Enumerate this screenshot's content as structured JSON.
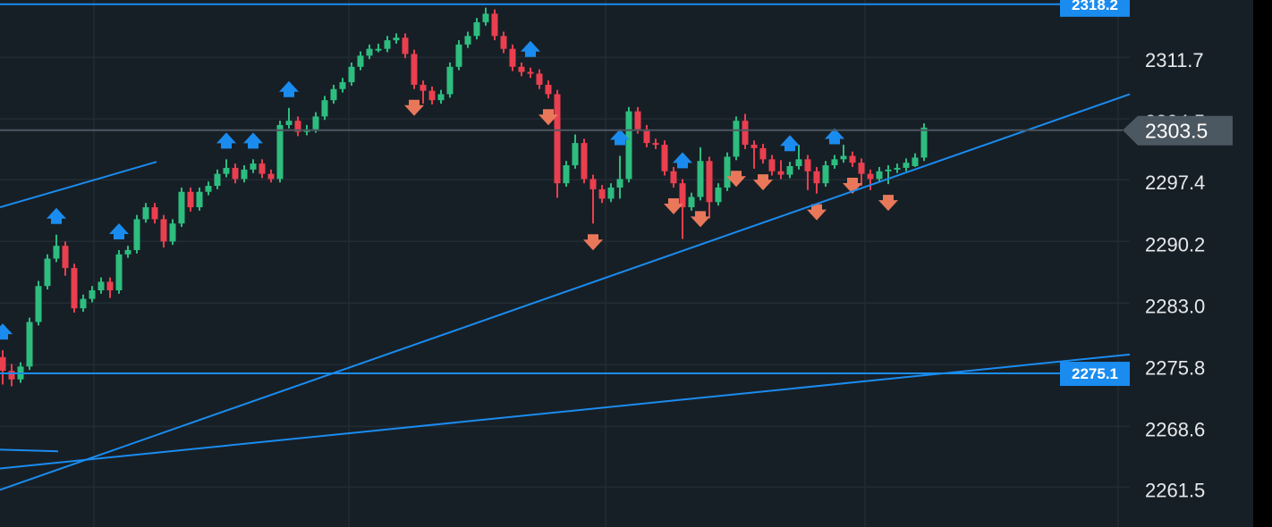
{
  "chart_data": {
    "type": "candlestick",
    "title": "",
    "y_axis": {
      "ticks": [
        "2311.7",
        "2304.5",
        "2297.4",
        "2290.2",
        "2283.0",
        "2275.8",
        "2268.6",
        "2261.5"
      ],
      "tick_values": [
        2311.7,
        2304.5,
        2297.4,
        2290.2,
        2283.0,
        2275.8,
        2268.6,
        2261.5
      ],
      "range": [
        2258.0,
        2318.7
      ]
    },
    "grid": true,
    "last_price": {
      "value": 2303.5,
      "label": "2303.5"
    },
    "horizontal_levels": [
      {
        "value": 2318.2,
        "label": "2318.2"
      },
      {
        "value": 2275.1,
        "label": "2275.1"
      }
    ],
    "trendlines": [
      {
        "from": [
          -0.3,
          2294.5
        ],
        "to": [
          17.2,
          2299.8
        ]
      },
      {
        "from": [
          -0.3,
          2261.5
        ],
        "to": [
          126.0,
          2307.7
        ]
      },
      {
        "from": [
          -0.3,
          2264.0
        ],
        "to": [
          126.0,
          2277.3
        ]
      },
      {
        "from": [
          -0.3,
          2266.2
        ],
        "to": [
          6.2,
          2266.0
        ]
      }
    ],
    "signals": {
      "buy": [
        0,
        6,
        13,
        25,
        28,
        32,
        59,
        69,
        76,
        88,
        93
      ],
      "sell": [
        46,
        61,
        66,
        75,
        78,
        82,
        85,
        91,
        95,
        99
      ]
    },
    "candles": [
      [
        2277.0,
        2277.8,
        2273.8,
        2275.4
      ],
      [
        2275.4,
        2276.2,
        2273.6,
        2274.4
      ],
      [
        2274.4,
        2276.4,
        2274.0,
        2275.9
      ],
      [
        2275.9,
        2281.6,
        2275.5,
        2281.1
      ],
      [
        2281.1,
        2285.9,
        2280.7,
        2285.3
      ],
      [
        2285.3,
        2289.0,
        2284.9,
        2288.5
      ],
      [
        2288.5,
        2291.3,
        2288.1,
        2290.0
      ],
      [
        2290.0,
        2290.5,
        2286.5,
        2287.4
      ],
      [
        2287.4,
        2287.9,
        2282.2,
        2282.7
      ],
      [
        2282.7,
        2284.3,
        2282.3,
        2283.8
      ],
      [
        2283.8,
        2285.3,
        2283.4,
        2284.8
      ],
      [
        2284.8,
        2286.3,
        2284.4,
        2285.8
      ],
      [
        2285.8,
        2286.3,
        2283.9,
        2284.8
      ],
      [
        2284.8,
        2289.5,
        2284.4,
        2289.0
      ],
      [
        2289.0,
        2290.0,
        2288.6,
        2289.5
      ],
      [
        2289.5,
        2293.6,
        2289.1,
        2293.1
      ],
      [
        2293.1,
        2295.0,
        2292.7,
        2294.5
      ],
      [
        2294.5,
        2295.0,
        2292.6,
        2293.1
      ],
      [
        2293.1,
        2293.6,
        2289.8,
        2290.5
      ],
      [
        2290.5,
        2293.1,
        2290.1,
        2292.6
      ],
      [
        2292.6,
        2296.8,
        2292.2,
        2296.3
      ],
      [
        2296.3,
        2296.8,
        2294.0,
        2294.5
      ],
      [
        2294.5,
        2296.8,
        2294.1,
        2296.3
      ],
      [
        2296.3,
        2297.5,
        2295.9,
        2297.0
      ],
      [
        2297.0,
        2298.9,
        2296.6,
        2298.4
      ],
      [
        2298.4,
        2300.1,
        2298.0,
        2299.1
      ],
      [
        2299.1,
        2299.6,
        2297.3,
        2297.8
      ],
      [
        2297.8,
        2299.4,
        2297.4,
        2298.9
      ],
      [
        2298.9,
        2300.1,
        2298.5,
        2299.6
      ],
      [
        2299.6,
        2300.1,
        2297.9,
        2298.4
      ],
      [
        2298.4,
        2298.9,
        2297.4,
        2297.8
      ],
      [
        2297.8,
        2304.6,
        2297.4,
        2304.1
      ],
      [
        2304.1,
        2306.1,
        2303.7,
        2304.6
      ],
      [
        2304.6,
        2305.1,
        2302.8,
        2303.3
      ],
      [
        2303.3,
        2304.1,
        2302.9,
        2303.6
      ],
      [
        2303.6,
        2305.6,
        2303.2,
        2305.1
      ],
      [
        2305.1,
        2307.5,
        2304.7,
        2307.0
      ],
      [
        2307.0,
        2308.8,
        2306.6,
        2308.3
      ],
      [
        2308.3,
        2309.6,
        2307.9,
        2309.1
      ],
      [
        2309.1,
        2311.4,
        2308.7,
        2310.9
      ],
      [
        2310.9,
        2312.7,
        2310.5,
        2312.2
      ],
      [
        2312.2,
        2313.5,
        2311.8,
        2313.0
      ],
      [
        2313.0,
        2313.6,
        2312.6,
        2313.0
      ],
      [
        2313.0,
        2314.5,
        2312.6,
        2314.0
      ],
      [
        2314.0,
        2314.8,
        2313.6,
        2314.3
      ],
      [
        2314.3,
        2314.8,
        2311.9,
        2312.4
      ],
      [
        2312.4,
        2312.9,
        2308.3,
        2308.8
      ],
      [
        2308.8,
        2309.3,
        2306.6,
        2308.1
      ],
      [
        2308.1,
        2308.6,
        2306.5,
        2307.0
      ],
      [
        2307.0,
        2308.2,
        2306.6,
        2307.7
      ],
      [
        2307.7,
        2311.4,
        2307.3,
        2310.9
      ],
      [
        2310.9,
        2314.0,
        2310.5,
        2313.5
      ],
      [
        2313.5,
        2315.0,
        2313.1,
        2314.5
      ],
      [
        2314.5,
        2316.6,
        2314.1,
        2316.1
      ],
      [
        2316.1,
        2317.8,
        2315.7,
        2317.1
      ],
      [
        2317.1,
        2317.6,
        2314.0,
        2314.5
      ],
      [
        2314.5,
        2315.0,
        2312.5,
        2313.0
      ],
      [
        2313.0,
        2313.5,
        2310.4,
        2310.9
      ],
      [
        2310.9,
        2311.4,
        2309.8,
        2310.3
      ],
      [
        2310.3,
        2310.8,
        2309.6,
        2310.1
      ],
      [
        2310.1,
        2310.6,
        2308.3,
        2308.8
      ],
      [
        2308.8,
        2309.3,
        2307.2,
        2307.7
      ],
      [
        2307.7,
        2308.2,
        2295.6,
        2297.3
      ],
      [
        2297.3,
        2299.9,
        2296.9,
        2299.4
      ],
      [
        2299.4,
        2303.0,
        2299.0,
        2302.0
      ],
      [
        2302.0,
        2302.5,
        2297.3,
        2297.8
      ],
      [
        2297.8,
        2298.3,
        2292.6,
        2296.6
      ],
      [
        2296.6,
        2297.1,
        2295.0,
        2295.5
      ],
      [
        2295.5,
        2297.3,
        2295.1,
        2296.8
      ],
      [
        2296.8,
        2300.5,
        2295.5,
        2297.8
      ],
      [
        2297.8,
        2306.2,
        2297.4,
        2305.7
      ],
      [
        2305.7,
        2306.2,
        2303.1,
        2303.6
      ],
      [
        2303.6,
        2304.1,
        2301.5,
        2302.0
      ],
      [
        2302.0,
        2302.5,
        2301.3,
        2301.8
      ],
      [
        2301.8,
        2302.3,
        2298.2,
        2298.7
      ],
      [
        2298.7,
        2299.2,
        2296.8,
        2297.3
      ],
      [
        2297.3,
        2297.8,
        2290.8,
        2294.5
      ],
      [
        2294.5,
        2296.2,
        2294.1,
        2295.7
      ],
      [
        2295.7,
        2301.5,
        2295.3,
        2299.9
      ],
      [
        2299.9,
        2300.4,
        2293.2,
        2295.1
      ],
      [
        2295.1,
        2297.3,
        2294.7,
        2296.8
      ],
      [
        2296.8,
        2300.9,
        2296.4,
        2300.4
      ],
      [
        2300.4,
        2305.1,
        2300.0,
        2304.6
      ],
      [
        2304.6,
        2305.4,
        2301.3,
        2301.8
      ],
      [
        2301.8,
        2302.3,
        2299.0,
        2301.4
      ],
      [
        2301.4,
        2301.9,
        2299.6,
        2300.1
      ],
      [
        2300.1,
        2300.6,
        2298.2,
        2298.7
      ],
      [
        2298.7,
        2300.0,
        2297.8,
        2298.3
      ],
      [
        2298.3,
        2299.8,
        2297.9,
        2299.3
      ],
      [
        2299.3,
        2301.8,
        2298.9,
        2300.1
      ],
      [
        2300.1,
        2300.6,
        2296.5,
        2298.7
      ],
      [
        2298.7,
        2299.2,
        2296.1,
        2297.3
      ],
      [
        2297.3,
        2299.9,
        2296.9,
        2299.4
      ],
      [
        2299.4,
        2300.6,
        2299.0,
        2300.1
      ],
      [
        2300.1,
        2301.8,
        2299.7,
        2300.5
      ],
      [
        2300.5,
        2301.0,
        2299.2,
        2299.7
      ],
      [
        2299.7,
        2300.2,
        2297.0,
        2298.4
      ],
      [
        2298.4,
        2298.9,
        2296.5,
        2297.8
      ],
      [
        2297.8,
        2299.2,
        2297.4,
        2298.7
      ],
      [
        2298.7,
        2299.4,
        2297.2,
        2298.9
      ],
      [
        2298.9,
        2299.6,
        2298.5,
        2299.1
      ],
      [
        2299.1,
        2300.2,
        2298.7,
        2299.7
      ],
      [
        2299.3,
        2300.8,
        2299.2,
        2300.3
      ],
      [
        2300.3,
        2304.3,
        2299.9,
        2303.8
      ]
    ],
    "colors": {
      "background": "#171f26",
      "grid": "#222c34",
      "up": "#2dbd7f",
      "down": "#ea3f4f",
      "buy_signal": "#1a8cf0",
      "sell_signal": "#e9785a",
      "drawing": "#1a8cf0",
      "last_price": "#4b5761"
    }
  }
}
